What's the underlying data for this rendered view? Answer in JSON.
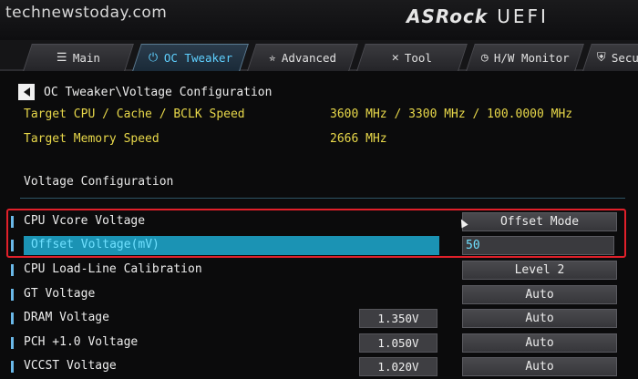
{
  "watermark": "technewstoday.com",
  "brand": {
    "name": "ASRock",
    "product": "UEFI"
  },
  "tabs": [
    {
      "label": "Main",
      "icon": "list-icon",
      "glyph": "☰"
    },
    {
      "label": "OC Tweaker",
      "icon": "power-icon",
      "glyph": "⏻"
    },
    {
      "label": "Advanced",
      "icon": "star-icon",
      "glyph": "✮"
    },
    {
      "label": "Tool",
      "icon": "tools-icon",
      "glyph": "✕"
    },
    {
      "label": "H/W Monitor",
      "icon": "monitor-icon",
      "glyph": "◷"
    },
    {
      "label": "Secu",
      "icon": "shield-icon",
      "glyph": "⛨"
    }
  ],
  "active_tab": "OC Tweaker",
  "breadcrumb": "OC Tweaker\\Voltage Configuration",
  "info": [
    {
      "label": "Target CPU / Cache / BCLK Speed",
      "value": "3600 MHz / 3300 MHz / 100.0000 MHz"
    },
    {
      "label": "Target Memory Speed",
      "value": "2666 MHz"
    }
  ],
  "section_title": "Voltage Configuration",
  "settings": [
    {
      "label": "CPU Vcore Voltage",
      "current": "",
      "value": "Offset Mode"
    },
    {
      "label": "Offset Voltage(mV)",
      "current": "",
      "value": "50"
    },
    {
      "label": "CPU Load-Line Calibration",
      "current": "",
      "value": "Level 2"
    },
    {
      "label": "GT Voltage",
      "current": "",
      "value": "Auto"
    },
    {
      "label": "DRAM Voltage",
      "current": "1.350V",
      "value": "Auto"
    },
    {
      "label": "PCH +1.0 Voltage",
      "current": "1.050V",
      "value": "Auto"
    },
    {
      "label": "VCCST Voltage",
      "current": "1.020V",
      "value": "Auto"
    }
  ],
  "colors": {
    "accent": "#5fd0ff",
    "selected": "#1b93b4",
    "info_text": "#e8d84a",
    "highlight_box": "#e0202a"
  }
}
